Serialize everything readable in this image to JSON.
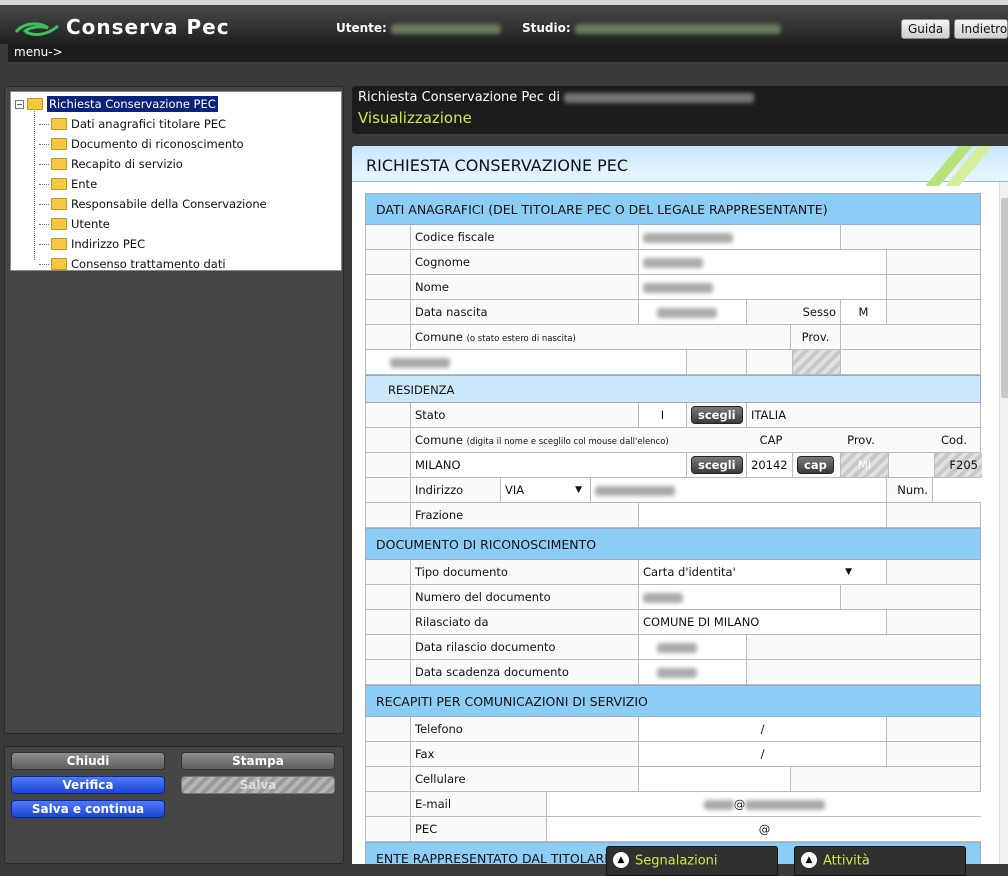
{
  "app": {
    "title": "Conserva Pec"
  },
  "header": {
    "user_label": "Utente:",
    "studio_label": "Studio:",
    "help_label": "Guida",
    "back_label": "Indietro",
    "menu_label": "menu->"
  },
  "tree": {
    "root": "Richiesta Conservazione PEC",
    "items": [
      "Dati anagrafici titolare PEC",
      "Documento di riconoscimento",
      "Recapito di servizio",
      "Ente",
      "Responsabile della Conservazione",
      "Utente",
      "Indirizzo PEC",
      "Consenso trattamento dati"
    ]
  },
  "actions": {
    "close": "Chiudi",
    "print": "Stampa",
    "verify": "Verifica",
    "save": "Salva",
    "save_continue": "Salva e continua"
  },
  "main": {
    "title_prefix": "Richiesta Conservazione Pec di",
    "subtitle": "Visualizzazione",
    "panel_title": "RICHIESTA CONSERVAZIONE PEC"
  },
  "sections": {
    "anagrafici": {
      "title": "DATI ANAGRAFICI (DEL TITOLARE PEC O DEL LEGALE RAPPRESENTANTE)",
      "codice_fiscale": "Codice fiscale",
      "cognome": "Cognome",
      "nome": "Nome",
      "data_nascita": "Data nascita",
      "sesso_label": "Sesso",
      "sesso_value": "M",
      "comune_label": "Comune",
      "comune_hint": "(o stato estero di nascita)",
      "prov_label": "Prov."
    },
    "residenza": {
      "title": "RESIDENZA",
      "stato_label": "Stato",
      "stato_code": "I",
      "scegli": "scegli",
      "stato_value": "ITALIA",
      "comune_label": "Comune",
      "comune_hint": "(digita il nome e sceglilo col mouse dall'elenco)",
      "cap_label": "CAP",
      "prov_label": "Prov.",
      "cod_label": "Cod.",
      "comune_value": "MILANO",
      "cap_value": "20142",
      "cap_button": "cap",
      "prov_value": "MI",
      "cod_value": "F205",
      "indirizzo_label": "Indirizzo",
      "indirizzo_type": "VIA",
      "num_label": "Num.",
      "frazione_label": "Frazione"
    },
    "documento": {
      "title": "DOCUMENTO DI RICONOSCIMENTO",
      "tipo_label": "Tipo documento",
      "tipo_value": "Carta d'identita'",
      "numero_label": "Numero del documento",
      "rilasciato_label": "Rilasciato da",
      "rilasciato_value": "COMUNE DI MILANO",
      "data_rilascio_label": "Data rilascio documento",
      "data_scadenza_label": "Data scadenza documento"
    },
    "recapiti": {
      "title": "RECAPITI PER COMUNICAZIONI DI SERVIZIO",
      "telefono": "Telefono",
      "fax": "Fax",
      "cellulare": "Cellulare",
      "email": "E-mail",
      "pec": "PEC",
      "slash": "/",
      "at": "@"
    },
    "ente": {
      "title": "ENTE RAPPRESENTATO DAL TITOLARE"
    }
  },
  "bottom": {
    "signals": "Segnalazioni",
    "activity": "Attività"
  },
  "colors": {
    "accent": "#cde84b",
    "section": "#8ccdf6",
    "selected": "#0b237a"
  }
}
